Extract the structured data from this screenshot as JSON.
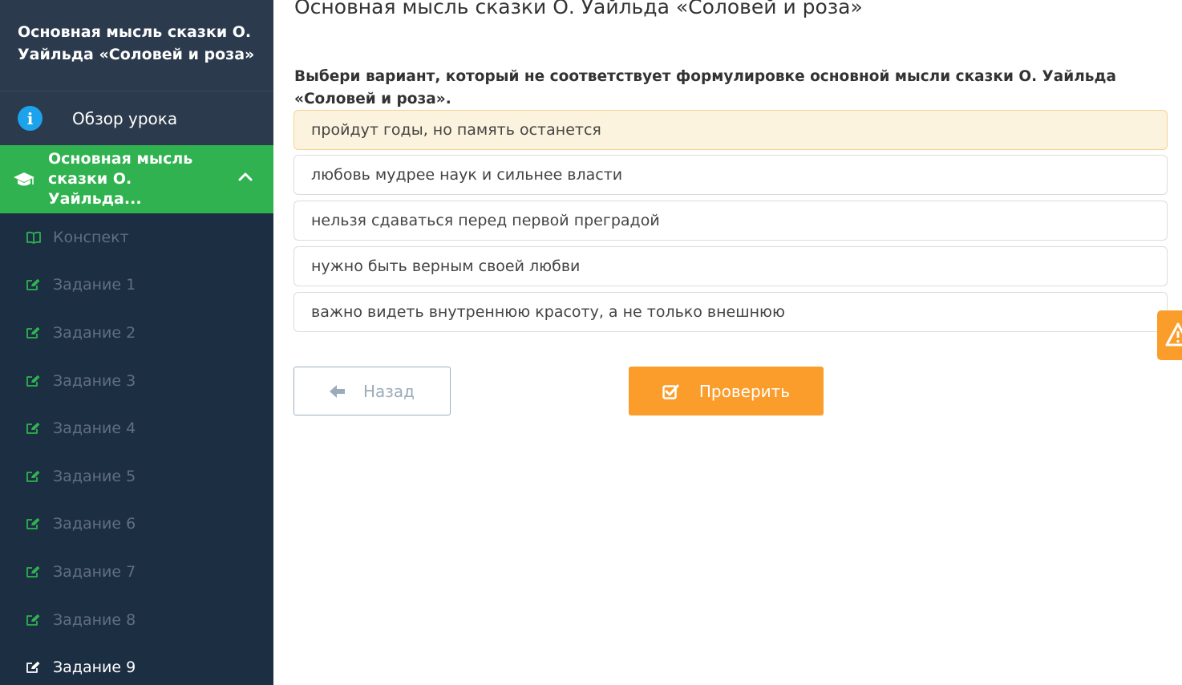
{
  "sidebar": {
    "lesson_title": "Основная мысль сказки О. Уайльда «Соловей и роза»",
    "overview_label": "Обзор урока",
    "active_section_label": "Основная мысль сказки О. Уайльда...",
    "items": [
      {
        "label": "Конспект",
        "icon": "book-icon"
      },
      {
        "label": "Задание 1",
        "icon": "edit-icon"
      },
      {
        "label": "Задание 2",
        "icon": "edit-icon"
      },
      {
        "label": "Задание 3",
        "icon": "edit-icon"
      },
      {
        "label": "Задание 4",
        "icon": "edit-icon"
      },
      {
        "label": "Задание 5",
        "icon": "edit-icon"
      },
      {
        "label": "Задание 6",
        "icon": "edit-icon"
      },
      {
        "label": "Задание 7",
        "icon": "edit-icon"
      },
      {
        "label": "Задание 8",
        "icon": "edit-icon"
      },
      {
        "label": "Задание 9",
        "icon": "edit-icon",
        "current": true
      }
    ]
  },
  "main": {
    "heading": "Основная мысль сказки О. Уайльда «Соловей и роза»",
    "question": "Выбери вариант, который не соответствует формулировке основной мысли сказки О. Уайльда «Соловей и роза».",
    "answers": [
      {
        "text": "пройдут годы, но память останется",
        "selected": true
      },
      {
        "text": "любовь мудрее наук и сильнее власти",
        "selected": false
      },
      {
        "text": "нельзя сдаваться перед первой преградой",
        "selected": false
      },
      {
        "text": "нужно быть верным своей любви",
        "selected": false
      },
      {
        "text": "важно видеть внутреннюю красоту, а не только внешнюю",
        "selected": false
      }
    ],
    "back_label": "Назад",
    "check_label": "Проверить"
  },
  "colors": {
    "sidebar_bg": "#1c2e42",
    "active_green": "#2fb24f",
    "accent_orange": "#fb9d2b",
    "selected_answer_bg": "#fcf3de"
  }
}
